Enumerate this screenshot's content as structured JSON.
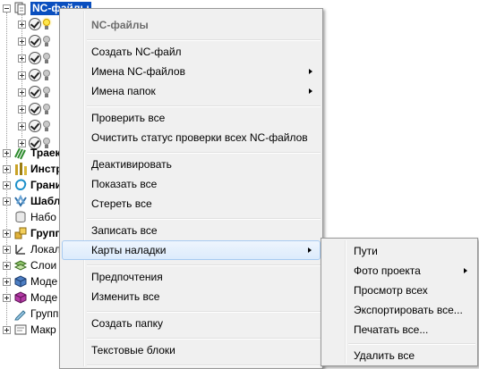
{
  "tree": {
    "root_label": "NC-файлы",
    "nodes": [
      {
        "label": "Траек",
        "bold": true,
        "icon": "toolpath-icon"
      },
      {
        "label": "Инстр",
        "bold": true,
        "icon": "tools-icon"
      },
      {
        "label": "Грани",
        "bold": true,
        "icon": "boundary-icon"
      },
      {
        "label": "Шабл",
        "bold": true,
        "icon": "template-icon"
      },
      {
        "label": "Набо",
        "bold": false,
        "icon": "stock-icon"
      },
      {
        "label": "Групп",
        "bold": true,
        "icon": "group-icon"
      },
      {
        "label": "Локал",
        "bold": false,
        "icon": "local-workplane-icon"
      },
      {
        "label": "Слои",
        "bold": false,
        "icon": "layers-icon"
      },
      {
        "label": "Моде",
        "bold": false,
        "icon": "model-icon"
      },
      {
        "label": "Моде",
        "bold": false,
        "icon": "model-alt-icon"
      },
      {
        "label": "Групп",
        "bold": false,
        "icon": "group-pencil-icon"
      },
      {
        "label": "Макр",
        "bold": false,
        "icon": "macro-icon"
      }
    ]
  },
  "menu": {
    "header": "NC-файлы",
    "items": [
      {
        "label": "Создать NC-файл",
        "submenu": false
      },
      {
        "label": "Имена NC-файлов",
        "submenu": true
      },
      {
        "label": "Имена папок",
        "submenu": true
      },
      {
        "label": "Проверить все",
        "submenu": false
      },
      {
        "label": "Очистить статус проверки всех NC-файлов",
        "submenu": false
      },
      {
        "label": "Деактивировать",
        "submenu": false
      },
      {
        "label": "Показать все",
        "submenu": false
      },
      {
        "label": "Стереть все",
        "submenu": false
      },
      {
        "label": "Записать все",
        "submenu": false
      },
      {
        "label": "Карты наладки",
        "submenu": true,
        "highlighted": true
      },
      {
        "label": "Предпочтения",
        "submenu": false
      },
      {
        "label": "Изменить все",
        "submenu": false
      },
      {
        "label": "Создать папку",
        "submenu": false
      },
      {
        "label": "Текстовые блоки",
        "submenu": false
      }
    ]
  },
  "submenu": {
    "items": [
      {
        "label": "Пути",
        "submenu": false
      },
      {
        "label": "Фото проекта",
        "submenu": true
      },
      {
        "label": "Просмотр всех",
        "submenu": false
      },
      {
        "label": "Экспортировать все...",
        "submenu": false
      },
      {
        "label": "Печатать все...",
        "submenu": false
      },
      {
        "label": "Удалить все",
        "submenu": false
      }
    ]
  },
  "colors": {
    "selection": "#0a4fbf",
    "menu_background": "#f0f0f0",
    "menu_highlight": "#dcebfc",
    "menu_header_text": "#6d6d6d"
  }
}
